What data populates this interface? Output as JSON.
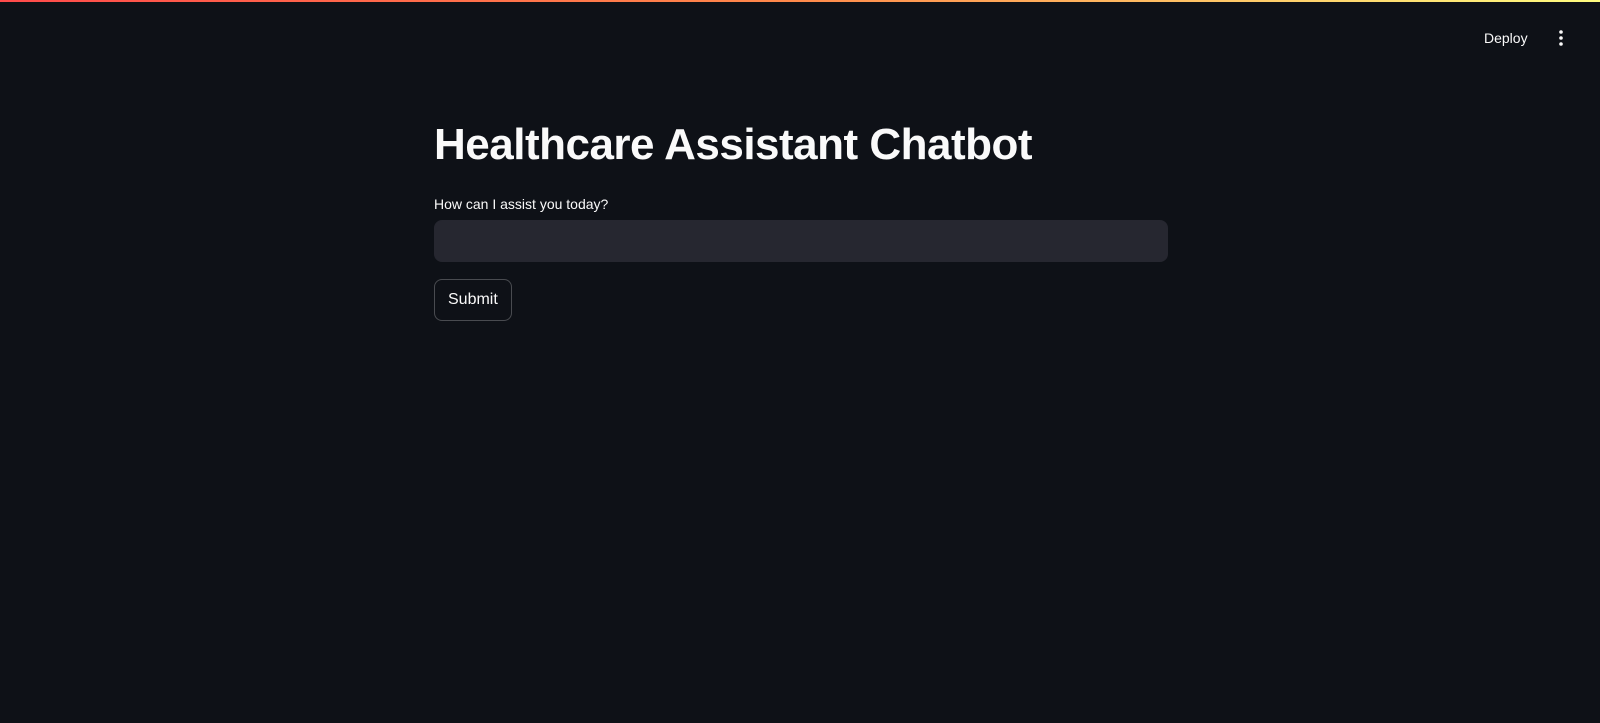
{
  "header": {
    "deploy_label": "Deploy",
    "menu_icon": "more-vertical-icon"
  },
  "main": {
    "title": "Healthcare Assistant Chatbot",
    "question_label": "How can I assist you today?",
    "question_value": "",
    "question_placeholder": "",
    "submit_label": "Submit"
  },
  "colors": {
    "background": "#0e1117",
    "input_background": "#262730",
    "text": "#fafafa",
    "top_gradient_start": "#ff4b4b",
    "top_gradient_end": "#fffd80"
  }
}
